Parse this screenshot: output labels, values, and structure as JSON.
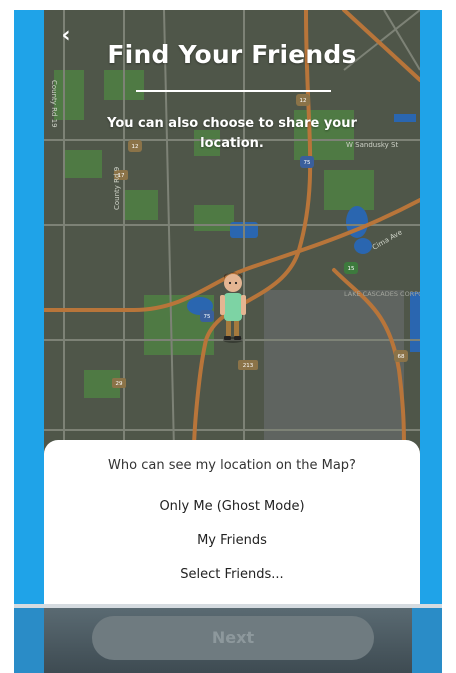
{
  "header": {
    "title": "Find Your Friends",
    "subtitle": "You can also choose to share your location."
  },
  "map": {
    "road_labels": [
      "County Rd 19",
      "County Rd 9",
      "W Sandusky St",
      "Cima Ave",
      "LAKE CASCADES CORPORATE CENTER"
    ],
    "route_shields": [
      "12",
      "12",
      "17",
      "75",
      "75",
      "15",
      "68",
      "213",
      "29"
    ]
  },
  "sheet": {
    "question": "Who can see my location on the Map?",
    "options": [
      "Only Me (Ghost Mode)",
      "My Friends",
      "Select Friends..."
    ]
  },
  "footer": {
    "next_label": "Next"
  },
  "colors": {
    "accent": "#1fa3e8",
    "map_bg": "#4f5649",
    "water": "#2a66b0",
    "park": "#4f7a44",
    "road": "#b8753a"
  },
  "icons": {
    "back": "chevron-left-icon",
    "avatar": "bitmoji-avatar-icon"
  }
}
